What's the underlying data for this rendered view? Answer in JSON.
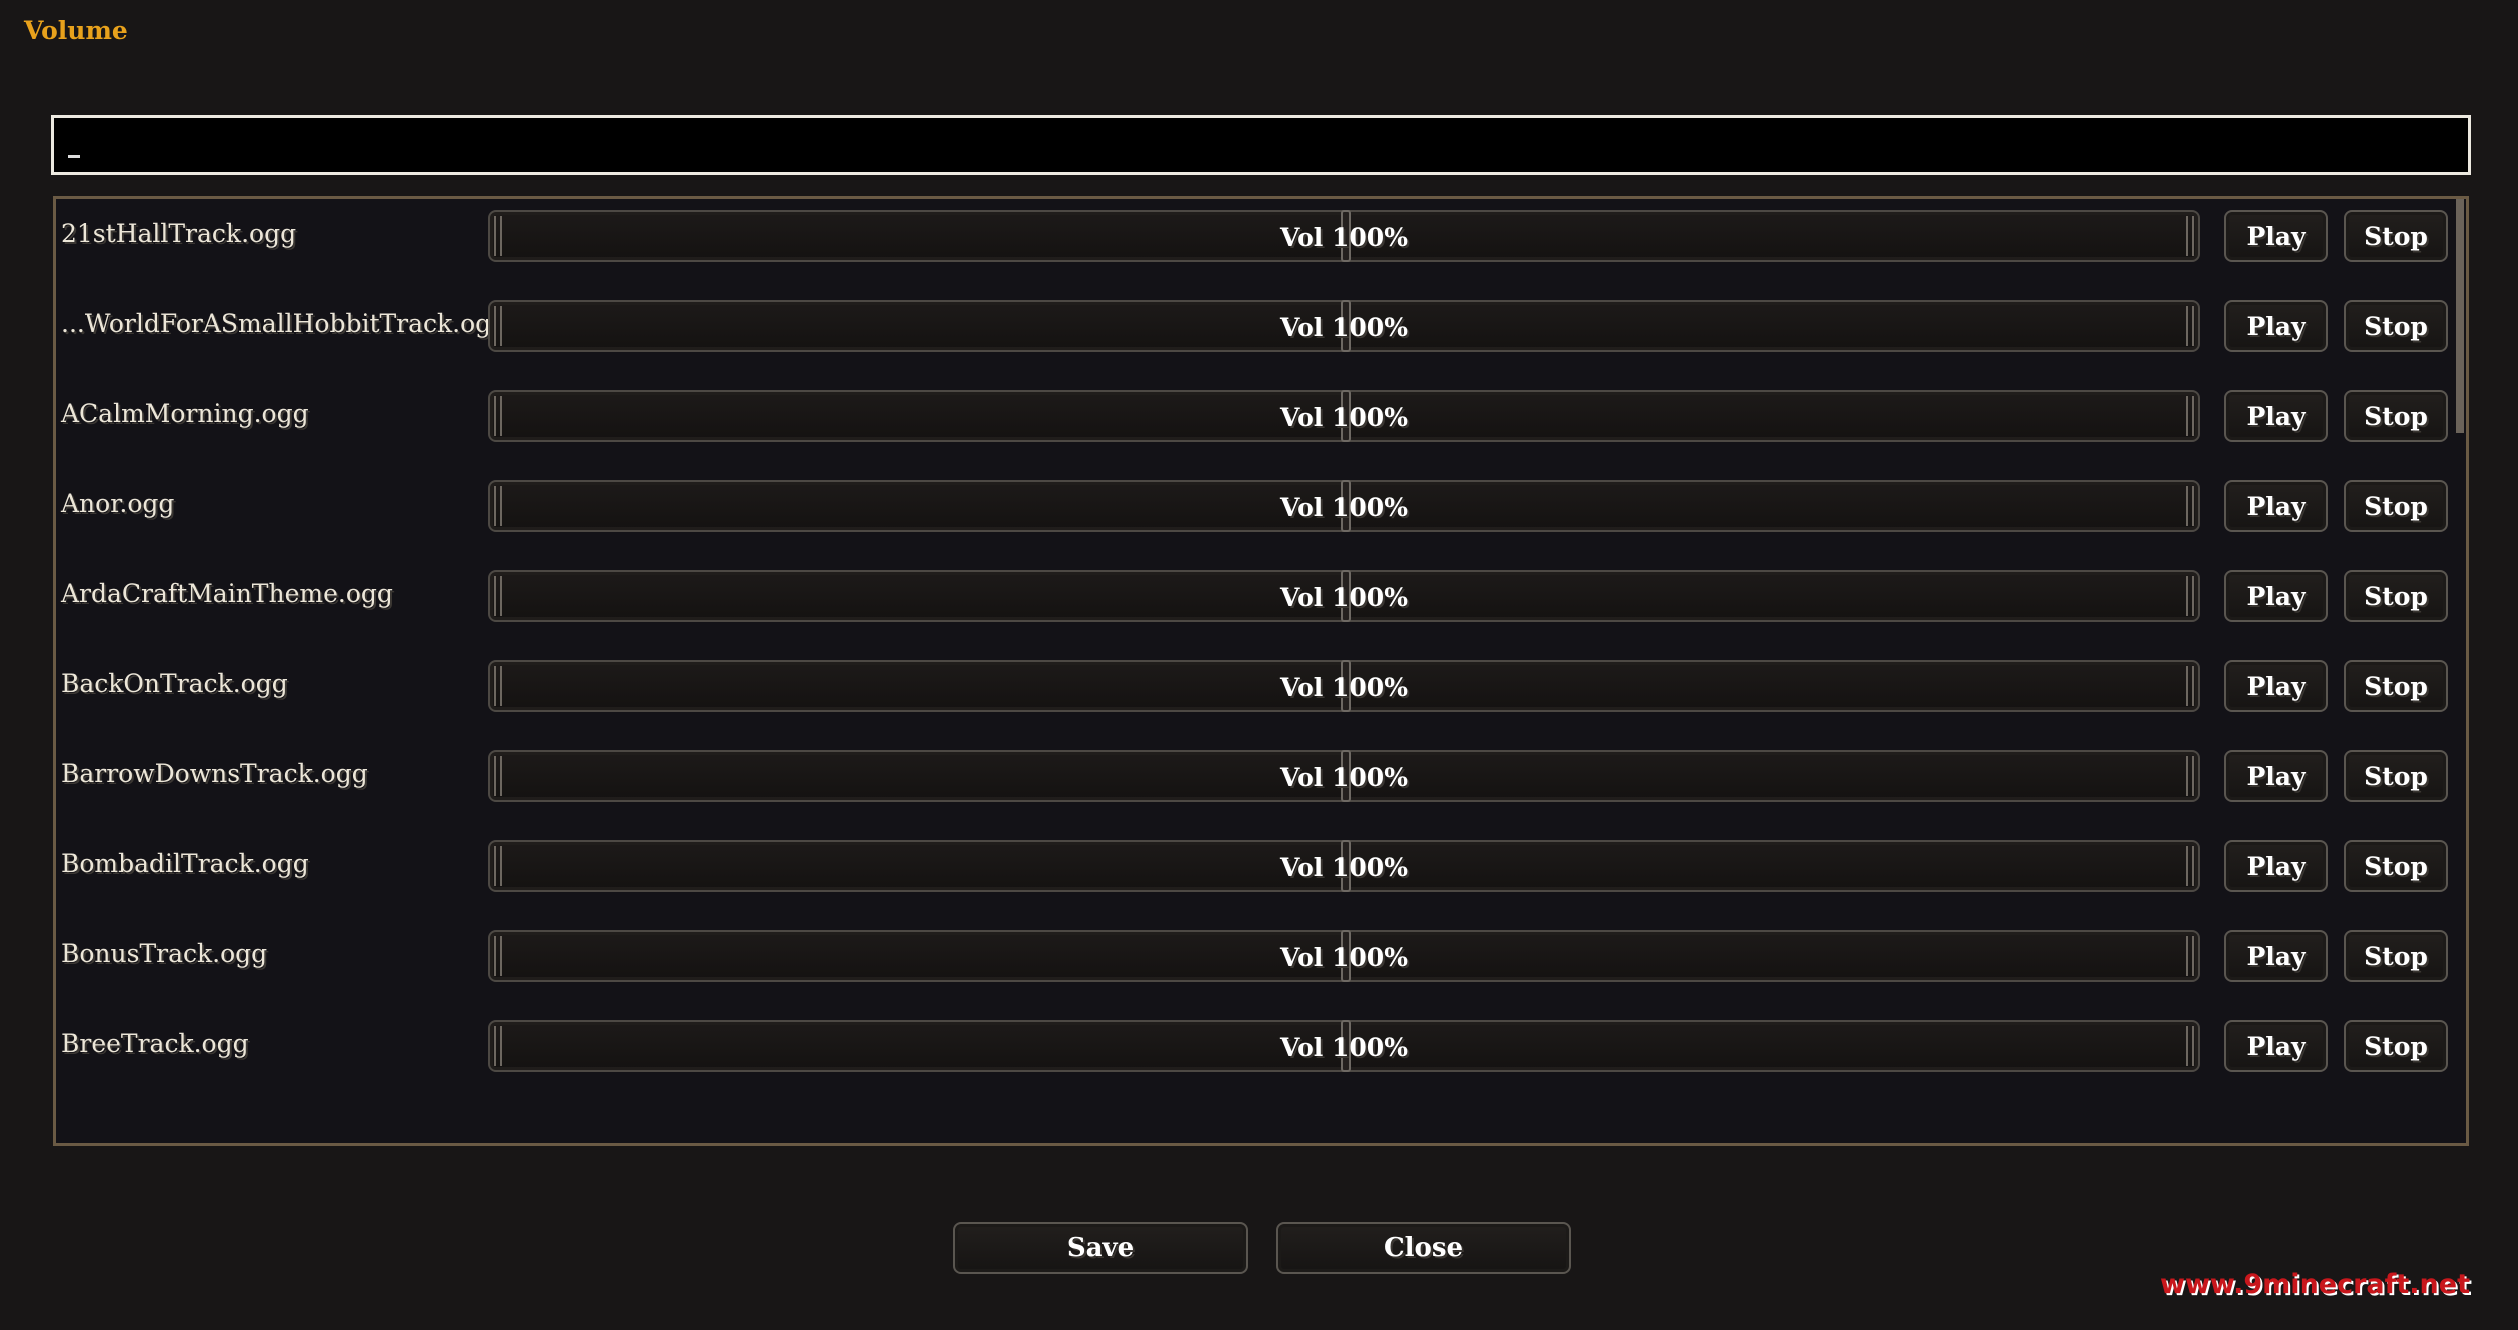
{
  "window": {
    "title": "Volume"
  },
  "search": {
    "value": ""
  },
  "tracks": [
    {
      "name": "21stHallTrack.ogg",
      "volume_label": "Vol 100%",
      "volume": 1.0,
      "play_label": "Play",
      "stop_label": "Stop"
    },
    {
      "name": "...WorldForASmallHobbitTrack.ogg",
      "volume_label": "Vol 100%",
      "volume": 1.0,
      "play_label": "Play",
      "stop_label": "Stop"
    },
    {
      "name": "ACalmMorning.ogg",
      "volume_label": "Vol 100%",
      "volume": 1.0,
      "play_label": "Play",
      "stop_label": "Stop"
    },
    {
      "name": "Anor.ogg",
      "volume_label": "Vol 100%",
      "volume": 1.0,
      "play_label": "Play",
      "stop_label": "Stop"
    },
    {
      "name": "ArdaCraftMainTheme.ogg",
      "volume_label": "Vol 100%",
      "volume": 1.0,
      "play_label": "Play",
      "stop_label": "Stop"
    },
    {
      "name": "BackOnTrack.ogg",
      "volume_label": "Vol 100%",
      "volume": 1.0,
      "play_label": "Play",
      "stop_label": "Stop"
    },
    {
      "name": "BarrowDownsTrack.ogg",
      "volume_label": "Vol 100%",
      "volume": 1.0,
      "play_label": "Play",
      "stop_label": "Stop"
    },
    {
      "name": "BombadilTrack.ogg",
      "volume_label": "Vol 100%",
      "volume": 1.0,
      "play_label": "Play",
      "stop_label": "Stop"
    },
    {
      "name": "BonusTrack.ogg",
      "volume_label": "Vol 100%",
      "volume": 1.0,
      "play_label": "Play",
      "stop_label": "Stop"
    },
    {
      "name": "BreeTrack.ogg",
      "volume_label": "Vol 100%",
      "volume": 1.0,
      "play_label": "Play",
      "stop_label": "Stop"
    }
  ],
  "footer": {
    "save_label": "Save",
    "close_label": "Close"
  },
  "watermark": "www.9minecraft.net",
  "colors": {
    "title": "#e8a21c",
    "background": "#181616",
    "list_border": "#6a5a44",
    "watermark": "#c8171c"
  }
}
